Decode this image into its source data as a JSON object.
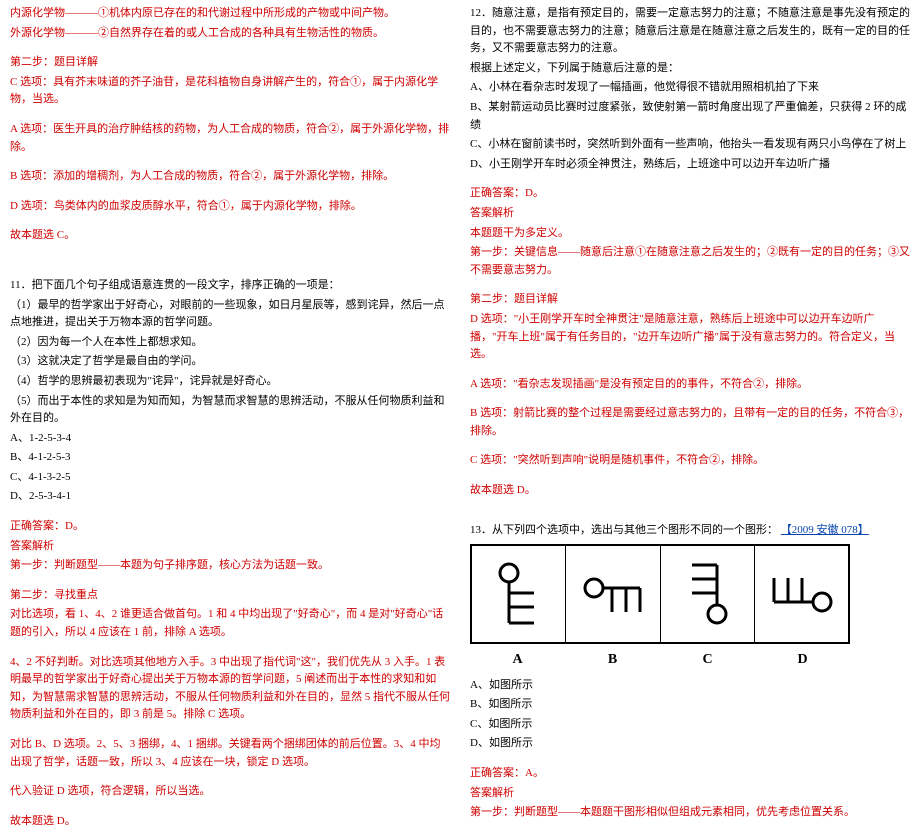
{
  "left": {
    "intro1": "内源化学物———①机体内原已存在的和代谢过程中所形成的产物或中间产物。",
    "intro2": "外源化学物———②自然界存在着的或人工合成的各种具有生物活性的物质。",
    "step2_title": "第二步：题目详解",
    "optC": "C 选项：具有芥末味道的芥子油苷，是花科植物自身讲解产生的，符合①，属于内源化学物，当选。",
    "optA": "A 选项：医生开具的治疗肿结核的药物，为人工合成的物质，符合②，属于外源化学物，排除。",
    "optB": "B 选项：添加的增稠剂，为人工合成的物质，符合②，属于外源化学物，排除。",
    "optD": "D 选项：鸟类体内的血浆皮质醇水平，符合①，属于内源化学物，排除。",
    "concl1": "故本题选 C。",
    "q11_title": "11．把下面几个句子组成语意连贯的一段文字，排序正确的一项是：",
    "q11_1": "（1）最早的哲学家出于好奇心，对眼前的一些现象，如日月星辰等，感到诧异，然后一点点地推进，提出关于万物本源的哲学问题。",
    "q11_2": "（2）因为每一个人在本性上都想求知。",
    "q11_3": "（3）这就决定了哲学是最自由的学问。",
    "q11_4": "（4）哲学的思辨最初表现为\"诧异\"，诧异就是好奇心。",
    "q11_5": "（5）而出于本性的求知是为知而知，为智慧而求智慧的思辨活动，不服从任何物质利益和外在目的。",
    "q11_a": "A、1-2-5-3-4",
    "q11_b": "B、4-1-2-5-3",
    "q11_c": "C、4-1-3-2-5",
    "q11_d": "D、2-5-3-4-1",
    "q11_ans": "正确答案：D。",
    "q11_jx": "答案解析",
    "q11_step1": "第一步：判断题型——本题为句子排序题，核心方法为话题一致。",
    "q11_step2_title": "第二步：寻找重点",
    "q11_step2_p1": "对比选项，看 1、4、2 谁更适合做首句。1 和 4 中均出现了\"好奇心\"，而 4 是对\"好奇心\"话题的引入，所以 4 应该在 1 前，排除 A 选项。",
    "q11_step2_p2": "4、2 不好判断。对比选项其他地方入手。3 中出现了指代词\"这\"，我们优先从 3 入手。1 表明最早的哲学家出于好奇心提出关于万物本源的哲学问题，5 阐述而出于本性的求知和如知，为智慧需求智慧的思辨活动，不服从任何物质利益和外在目的，显然 5 指代不服从任何物质利益和外在目的，即 3 前是 5。排除 C 选项。",
    "q11_step2_p3": "对比 B、D 选项。2、5、3 捆绑，4、1 捆绑。关键看两个捆绑团体的前后位置。3、4 中均出现了哲学，话题一致，所以 3、4 应该在一块，锁定 D 选项。",
    "q11_step2_p4": "代入验证 D 选项，符合逻辑，所以当选。",
    "q11_concl": "故本题选 D。"
  },
  "right": {
    "q12_line1": "12．随意注意，是指有预定目的，需要一定意志努力的注意；不随意注意是事先没有预定的目的，也不需要意志努力的注意；随意后注意是在随意注意之后发生的，既有一定的目的任务，又不需要意志努力的注意。",
    "q12_line2": "根据上述定义，下列属于随意后注意的是：",
    "q12_a": "A、小林在看杂志时发现了一幅插画，他觉得很不错就用照相机拍了下来",
    "q12_b": "B、某射箭运动员比赛时过度紧张，致使射第一箭时角度出现了严重偏差，只获得 2 环的成绩",
    "q12_c": "C、小林在窗前读书时，突然听到外面有一些声响，他抬头一看发现有两只小鸟停在了树上",
    "q12_d": "D、小王刚学开车时必须全神贯注，熟练后，上班途中可以边开车边听广播",
    "q12_ans": "正确答案：D。",
    "q12_jx": "答案解析",
    "q12_type": "本题题干为多定义。",
    "q12_step1": "第一步：关键信息——随意后注意①在随意注意之后发生的；②既有一定的目的任务；③又不需要意志努力。",
    "q12_step2_title": "第二步：题目详解",
    "q12_dopt": "D 选项：\"小王刚学开车时全神贯注\"是随意注意，熟练后上班途中可以边开车边听广播，\"开车上班\"属于有任务目的，\"边开车边听广播\"属于没有意志努力的。符合定义，当选。",
    "q12_aopt": "A 选项：\"看杂志发现插画\"是没有预定目的的事件，不符合②，排除。",
    "q12_bopt": "B 选项：射箭比赛的整个过程是需要经过意志努力的，且带有一定的目的任务，不符合③，排除。",
    "q12_copt": "C 选项：\"突然听到声响\"说明是随机事件，不符合②，排除。",
    "q12_concl": "故本题选 D。",
    "q13_title_p1": "13．从下列四个选项中，选出与其他三个图形不同的一个图形：",
    "q13_title_p2": "【2009 安徽 078】",
    "q13_labels": {
      "a": "A",
      "b": "B",
      "c": "C",
      "d": "D"
    },
    "q13_opts": {
      "a": "A、如图所示",
      "b": "B、如图所示",
      "c": "C、如图所示",
      "d": "D、如图所示"
    },
    "q13_ans": "正确答案：A。",
    "q13_jx": "答案解析",
    "q13_step1": "第一步：判断题型——本题题干图形相似但组成元素相同，优先考虑位置关系。"
  }
}
